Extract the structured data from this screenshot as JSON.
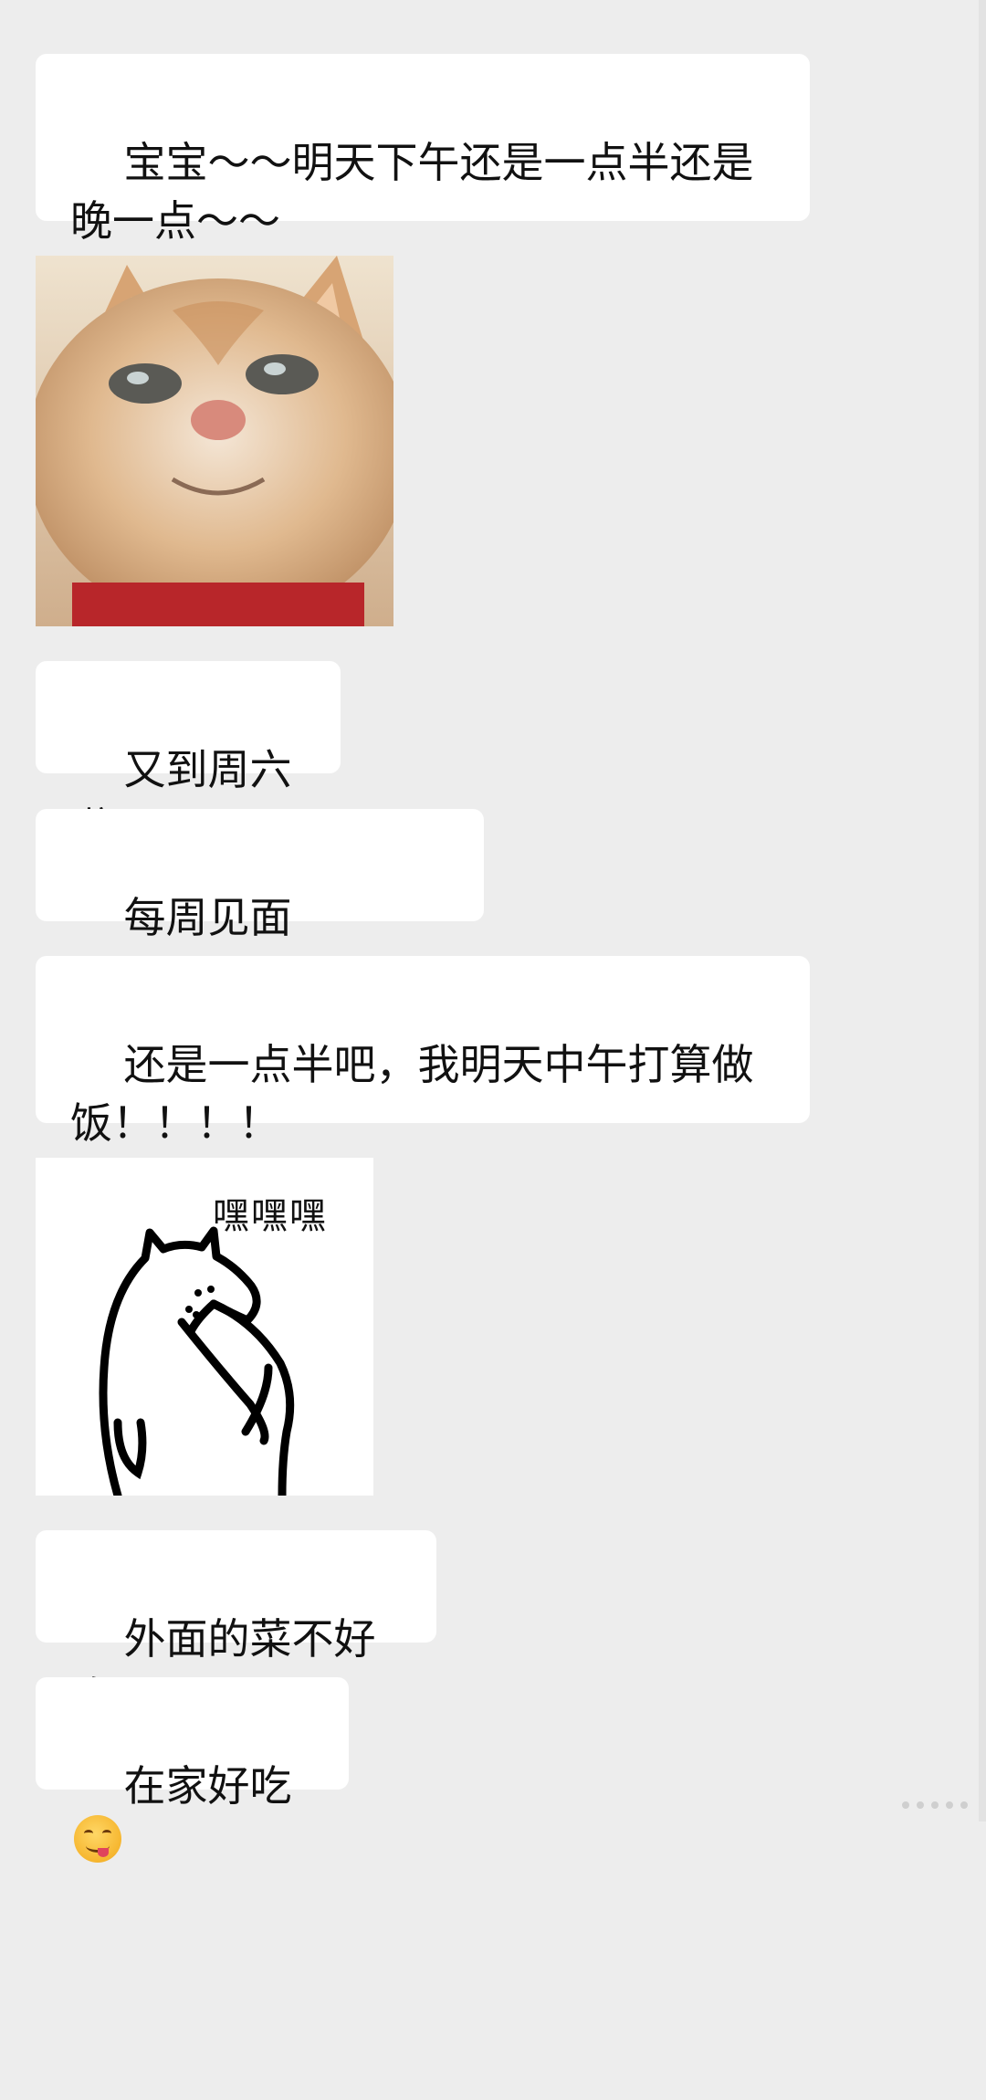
{
  "messages": [
    {
      "type": "text",
      "text": "宝宝～～明天下午还是一点半还是晚一点～～"
    },
    {
      "type": "sticker",
      "description": "cat close-up photo sticker"
    },
    {
      "type": "text",
      "text": "又到周六啦"
    },
    {
      "type": "text",
      "text": "每周见面日！！！"
    },
    {
      "type": "text",
      "text": "还是一点半吧，我明天中午打算做饭！！！！"
    },
    {
      "type": "sticker",
      "caption": "嘿嘿嘿"
    },
    {
      "type": "text",
      "text": "外面的菜不好吃"
    },
    {
      "type": "text",
      "text": "在家好吃",
      "emoji": "savoring-food-emoji"
    }
  ],
  "colors": {
    "background": "#ededed",
    "bubble": "#ffffff",
    "text": "#111111"
  }
}
